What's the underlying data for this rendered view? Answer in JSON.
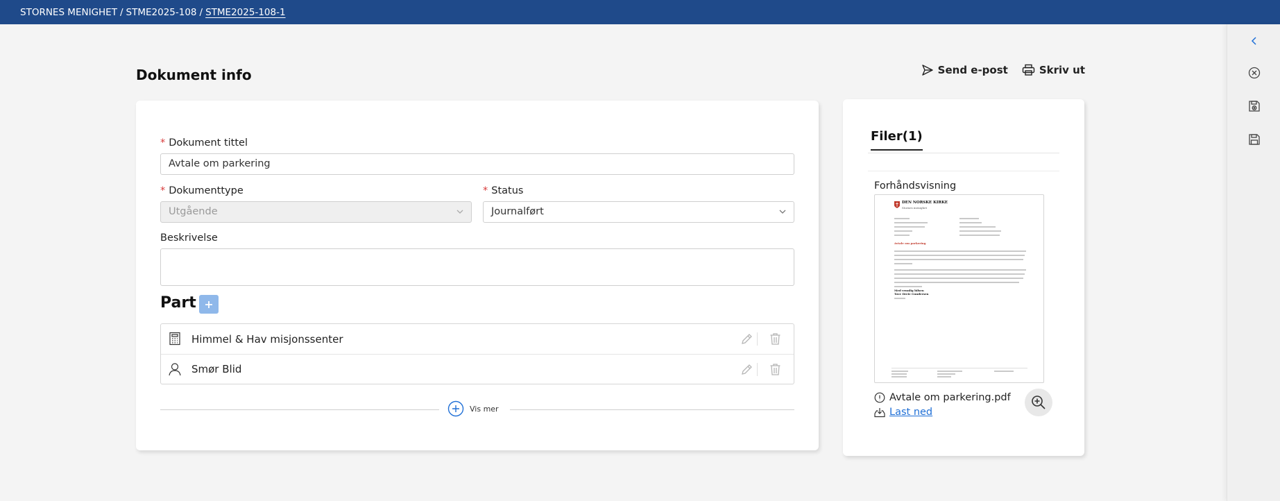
{
  "breadcrumb": {
    "items": [
      "STORNES MENIGHET",
      "STME2025-108"
    ],
    "separator": "/",
    "current": "STME2025-108-1"
  },
  "page": {
    "title": "Dokument info",
    "send_email_label": "Send e-post",
    "print_label": "Skriv ut"
  },
  "form": {
    "title_label": "Dokument tittel",
    "title_value": "Avtale om parkering",
    "doctype_label": "Dokumenttype",
    "doctype_value": "Utgående",
    "status_label": "Status",
    "status_value": "Journalført",
    "description_label": "Beskrivelse",
    "description_value": "",
    "required_marker": "*"
  },
  "parts": {
    "title": "Part",
    "add_icon": "plus-icon",
    "items": [
      {
        "name": "Himmel & Hav misjonssenter",
        "icon": "building-icon"
      },
      {
        "name": "Smør Blid",
        "icon": "person-icon"
      }
    ],
    "show_more_label": "Vis mer"
  },
  "files": {
    "tab_label": "Filer(1)",
    "preview_label": "Forhåndsvisning",
    "preview_doc": {
      "brand": "DEN NORSKE KIRKE",
      "brand_sub": "Stornes menighet",
      "heading": "Avtale om parkering",
      "closing": "Med vennlig hilsen",
      "signer": "Tove Dreie Gundersen"
    },
    "file_name": "Avtale om parkering.pdf",
    "download_label": "Last ned"
  },
  "colors": {
    "topbar": "#1f4a8a",
    "accent_blue": "#1f6fd6",
    "required_red": "#d83a3a",
    "add_button": "#8fb8ea"
  }
}
